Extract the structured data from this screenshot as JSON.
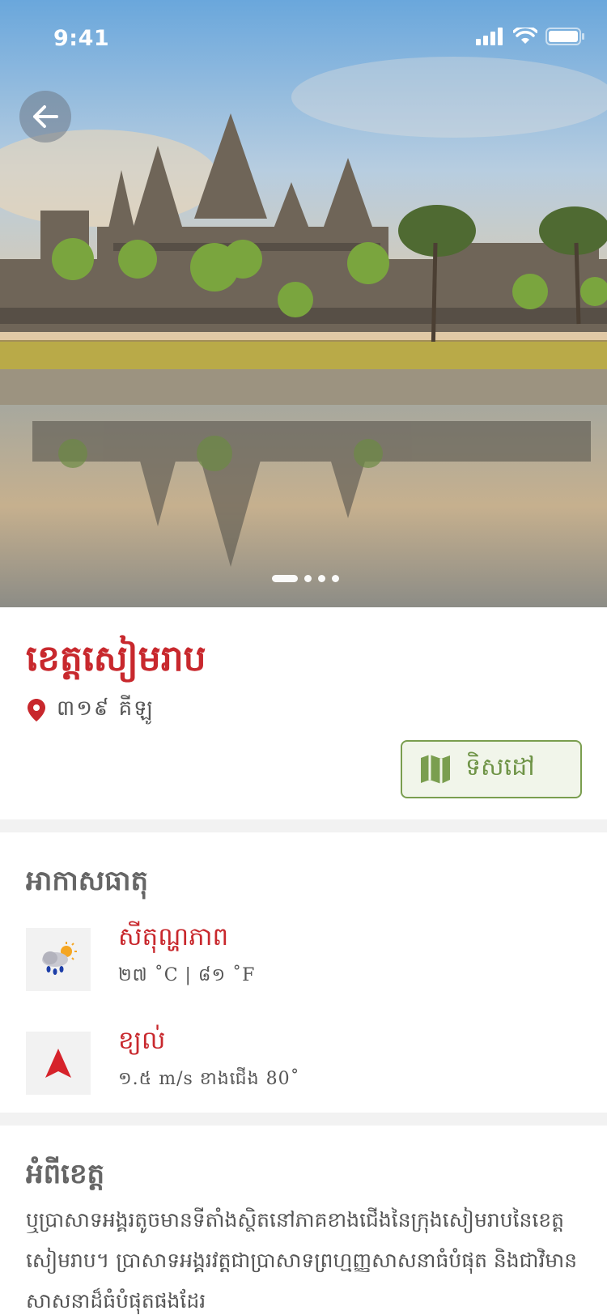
{
  "status_bar": {
    "time": "9:41",
    "icons": [
      "signal-icon",
      "wifi-icon",
      "battery-icon"
    ]
  },
  "hero": {
    "image": "angkor-wat-photo",
    "slide_count": 4,
    "active_slide": 1
  },
  "province": {
    "title": "ខេត្តសៀមរាប",
    "distance": "៣១៩ គីឡូ",
    "directions_label": "ទិសដៅ"
  },
  "weather": {
    "title": "អាកាសធាតុ",
    "temperature": {
      "label": "សីតុណ្ហភាព",
      "value": "២៧ ˚C | ៨១ ˚F",
      "icon": "rain-cloud-sun-icon"
    },
    "wind": {
      "label": "ខ្យល់",
      "value": "១.៥ m/s ខាងជើង 80˚",
      "icon": "wind-direction-arrow-icon"
    }
  },
  "about": {
    "title": "អំពីខេត្ត",
    "body": "ឬប្រាសាទអង្គរតូចមានទីតាំងស្ថិតនៅភាគខាងជើងនៃក្រុងសៀមរាបនៃខេត្តសៀមរាប។ ប្រាសាទអង្គរវត្តជាប្រាសាទព្រហ្មញ្ញសាសនាធំបំផុត និងជាវិមានសាសនាដ៏ធំបំផុតផងដែរ"
  },
  "colors": {
    "accent": "#c8282d",
    "green": "#7a9e4f",
    "divider": "#f2f2f2"
  }
}
